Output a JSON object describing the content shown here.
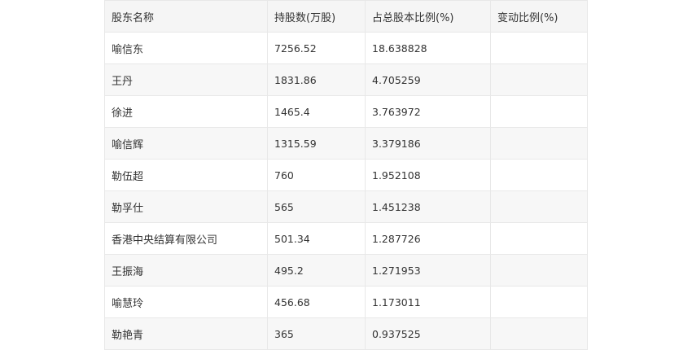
{
  "table": {
    "headers": [
      "股东名称",
      "持股数(万股)",
      "占总股本比例(%)",
      "变动比例(%)"
    ],
    "rows": [
      {
        "name": "喻信东",
        "shares": "7256.52",
        "ratio": "18.638828",
        "change": ""
      },
      {
        "name": "王丹",
        "shares": "1831.86",
        "ratio": "4.705259",
        "change": ""
      },
      {
        "name": "徐进",
        "shares": "1465.4",
        "ratio": "3.763972",
        "change": ""
      },
      {
        "name": "喻信辉",
        "shares": "1315.59",
        "ratio": "3.379186",
        "change": ""
      },
      {
        "name": "勒伍超",
        "shares": "760",
        "ratio": "1.952108",
        "change": ""
      },
      {
        "name": "勒孚仕",
        "shares": "565",
        "ratio": "1.451238",
        "change": ""
      },
      {
        "name": "香港中央结算有限公司",
        "shares": "501.34",
        "ratio": "1.287726",
        "change": ""
      },
      {
        "name": "王振海",
        "shares": "495.2",
        "ratio": "1.271953",
        "change": ""
      },
      {
        "name": "喻慧玲",
        "shares": "456.68",
        "ratio": "1.173011",
        "change": ""
      },
      {
        "name": "勒艳青",
        "shares": "365",
        "ratio": "0.937525",
        "change": ""
      }
    ]
  }
}
